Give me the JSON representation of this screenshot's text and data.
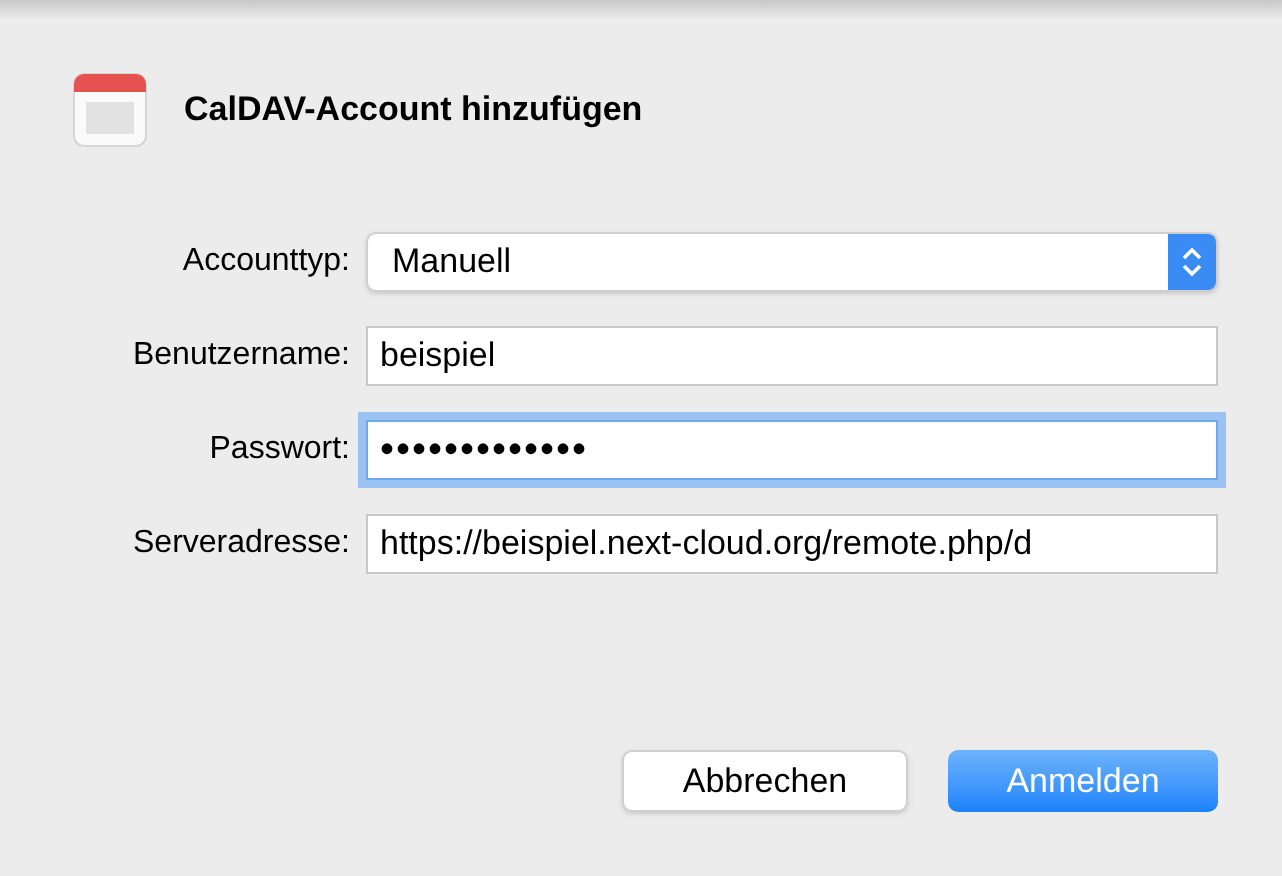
{
  "dialog": {
    "title": "CalDAV-Account hinzufügen"
  },
  "fields": [
    {
      "kind": "select",
      "label": "Accounttyp:",
      "value": "Manuell"
    },
    {
      "kind": "text",
      "label": "Benutzername:",
      "value": "beispiel",
      "focused": false
    },
    {
      "kind": "password",
      "label": "Passwort:",
      "value": "•••••••••••••",
      "focused": true
    },
    {
      "kind": "text",
      "label": "Serveradresse:",
      "value": "https://beispiel.next-cloud.org/remote.php/d",
      "focused": false
    }
  ],
  "buttons": [
    {
      "label": "Abbrechen",
      "kind": "secondary"
    },
    {
      "label": "Anmelden",
      "kind": "primary"
    }
  ]
}
